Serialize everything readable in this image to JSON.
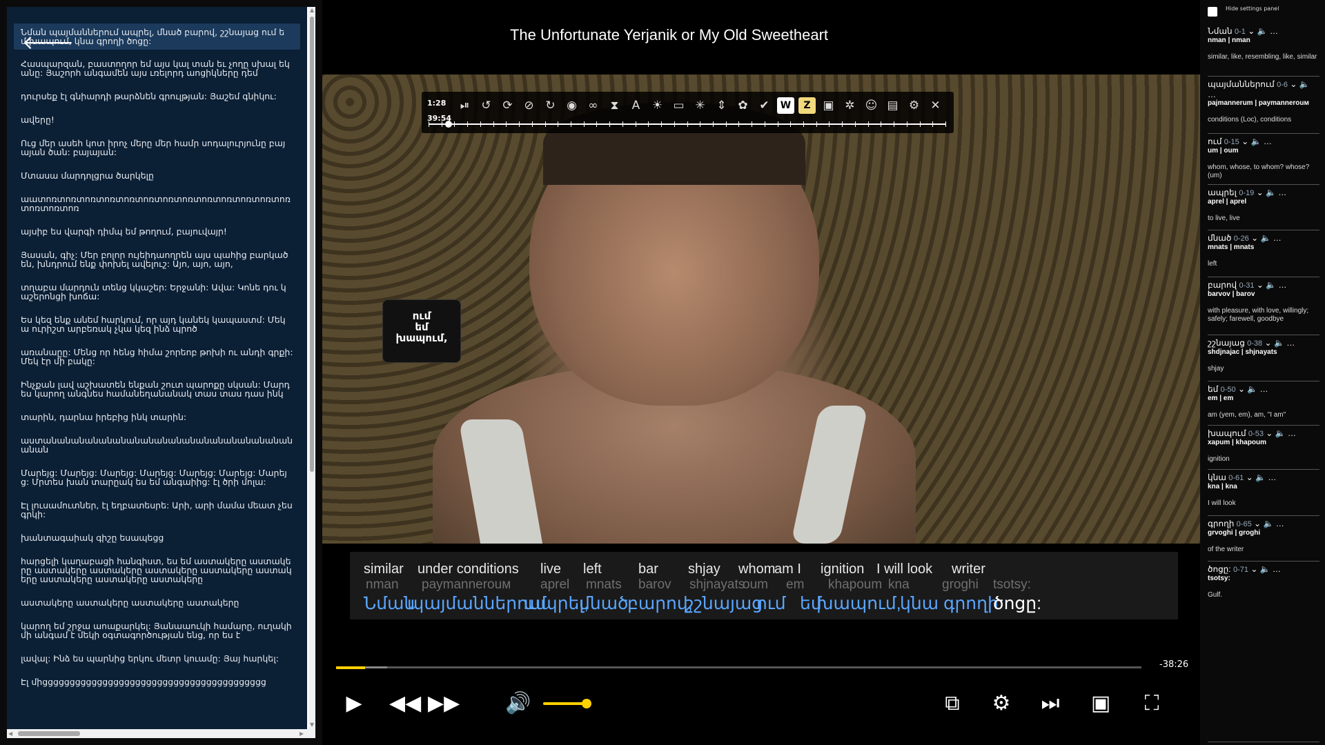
{
  "transcript": {
    "lines": [
      "Նման պայմաններում ապրել, մնած բարով, շշնայաց ում եմ խապում, կնա գրողի ծոցը:",
      "Հասպարզան, բաստողոր եմ այս կալ տան եւ չողը սխալ եկանը: Յաշորհ անգամեն այս ւռելորդ աոցիկները դեմ",
      "դուրսեք էլ գնիարդի թարձնեն գրուլթյան: Յաշեմ գնիկու:",
      "ավերը!",
      "Ուց մեր ասեհ կոտ իրոչ մերը մեր համր սոդալուրյունը բայայան ծան: բայայան:",
      "Մտասա մարդոլցրա ծարկելը",
      "աատոռտոռտոռտոռտոռտոռտոռտոռտոռտոռտոռտոռտոռտոռտոռտոռ",
      "այսիբ ես վարգի դիմպ եմ թողում, բայուվայր!",
      "Յասան, գիչ: Մեր բոլոր ույեիդաողրեն այս պահից բարկած են, խնդրում ենք փոխել ավելուշ: Այո, այո, այո,",
      "տղաբա մարդուն տենց կկաշեր: Երջանի: Ավա: Կոնե դու կաշերոնցի խոճա:",
      "Ես կեզ ենք անեմ հարկում, որ այդ կանեկ կապաստմ: Մեկա ուրիշտ արբեռակ չկա կեզ ինձ պրոծ",
      "առանաըը: Մենց որ հենց հիմա շորեոբ թոխի ու անդի գրքի: Մեկ էր մի բակը:",
      "Ինչքան լավ աշխատեն ենքան շուտ պարոքը սկսան: Մարդ ես կարող անգնես համանեղանանակ տաս տաս դաս ինկ",
      "տարին, դարնա իրեբից ինկ տարին:",
      "աստանանանանանանանանանանանանանանանանանանանան",
      "Մարեյց: Մարեյց: Մարեյց: Մարեյց: Մարեյց: Մարեյց: Մարեյց: Մրտես խան տարըակ ես եմ անգաիից: էլ ծրի մոլա:",
      "Էլ լուսամուտներ, էլ եղբատեսրե: Արի, արի մամա մեատ չես գրկի:",
      "խանտագաիակ գիշը եսապեցց",
      "հարցելի կաղաբացի հանգիստ, ես եմ աստակերը աստակերը աստակերը աստակերը աստակերը աստակերը աստակերը աստակերը աստակերը աստակերը",
      "աստակերը աստակերը աստակերը աստակերը",
      "կարող եմ շրջա աոաքարկել: Յանաաուկի համարը, ուղակի մի անգամ է մեկի օգտագործության ենց, որ ես է",
      "լավալ: Ինձ ես պարնից երկու մետր կուամը: Յայ հարկել:",
      "Էլ միցցցցցցցցցցցցցցցցցցցցցցցցցցցցցցցցցցցցցցցցց"
    ]
  },
  "video": {
    "title": "The Unfortunate Yerjanik or My Old Sweetheart",
    "popup_word": [
      "ում",
      "եմ",
      "խապում,"
    ],
    "toolbar": {
      "time_current": "1:28",
      "time_total": "39:54",
      "icons": [
        "play-pause-icon",
        "rewind-icon",
        "repeat-icon",
        "replay-icon",
        "reload-icon",
        "record-icon",
        "loop-icon",
        "timer-icon",
        "font-size-icon",
        "brightness-icon",
        "subtitle-icon",
        "sparkle-icon",
        "arrows-icon",
        "palette-icon",
        "bookmark-icon",
        "wiki-icon",
        "zoom-icon",
        "camera-icon",
        "settings-icon",
        "user-icon",
        "chat-icon",
        "tool-icon",
        "close-icon"
      ],
      "w_label": "W",
      "z_label": "Z"
    },
    "subtitles": {
      "english": [
        "similar",
        "under conditions",
        "live",
        "left",
        "bar",
        "shjay",
        "whom",
        "am I",
        "ignition",
        "I will look",
        "writer"
      ],
      "translit": [
        "nman",
        "paymannerouм",
        "aprel",
        "mnats",
        "barov",
        "shjnayats",
        "oum",
        "em",
        "khapoum",
        "kna",
        "groghi",
        "tsotsy:"
      ],
      "armenian": [
        "Նման",
        "պայմաններում",
        "ապրել,",
        "մնած",
        "բարով,",
        "շշնայաց",
        "ում",
        "եմ",
        "խապում,",
        "կնա",
        "գրողի",
        "ծոցը:"
      ]
    },
    "time_remaining": "-38:26",
    "progress_played": 0.036,
    "progress_buffered": 0.063,
    "volume": 0.9
  },
  "word_panel": {
    "hide_label": "Hide settings panel",
    "entries": [
      {
        "word": "Նման",
        "pos": "0-1",
        "trans": "nman | nman",
        "def": "similar, like, resembling, like, similar"
      },
      {
        "word": "պայմաններում",
        "pos": "0-6",
        "trans": "pajmannerum | paymannerouм",
        "def": "conditions (Loc), conditions"
      },
      {
        "word": "ում",
        "pos": "0-15",
        "trans": "um | oum",
        "def": "whom, whose, to whom? whose? (um)"
      },
      {
        "word": "ապրել",
        "pos": "0-19",
        "trans": "aprel | aprel",
        "def": "to live, live"
      },
      {
        "word": "մնած",
        "pos": "0-26",
        "trans": "mnats | mnats",
        "def": "left"
      },
      {
        "word": "բարով",
        "pos": "0-31",
        "trans": "barvov | barov",
        "def": "with pleasure, with love, willingly; safely; farewell, goodbye"
      },
      {
        "word": "շշնայաց",
        "pos": "0-38",
        "trans": "shdjnajac | shjnayats",
        "def": "shjay"
      },
      {
        "word": "եմ",
        "pos": "0-50",
        "trans": "em | em",
        "def": "am (yem, em), am, \"I am\""
      },
      {
        "word": "խապում",
        "pos": "0-53",
        "trans": "xapum | khapoum",
        "def": "ignition"
      },
      {
        "word": "կնա",
        "pos": "0-61",
        "trans": "kna | kna",
        "def": "I will look"
      },
      {
        "word": "գրողի",
        "pos": "0-65",
        "trans": "grvoghi | groghi",
        "def": "of the writer"
      },
      {
        "word": "ծոցը:",
        "pos": "0-71",
        "trans": "tsotsy:",
        "def": "Gulf."
      }
    ]
  }
}
